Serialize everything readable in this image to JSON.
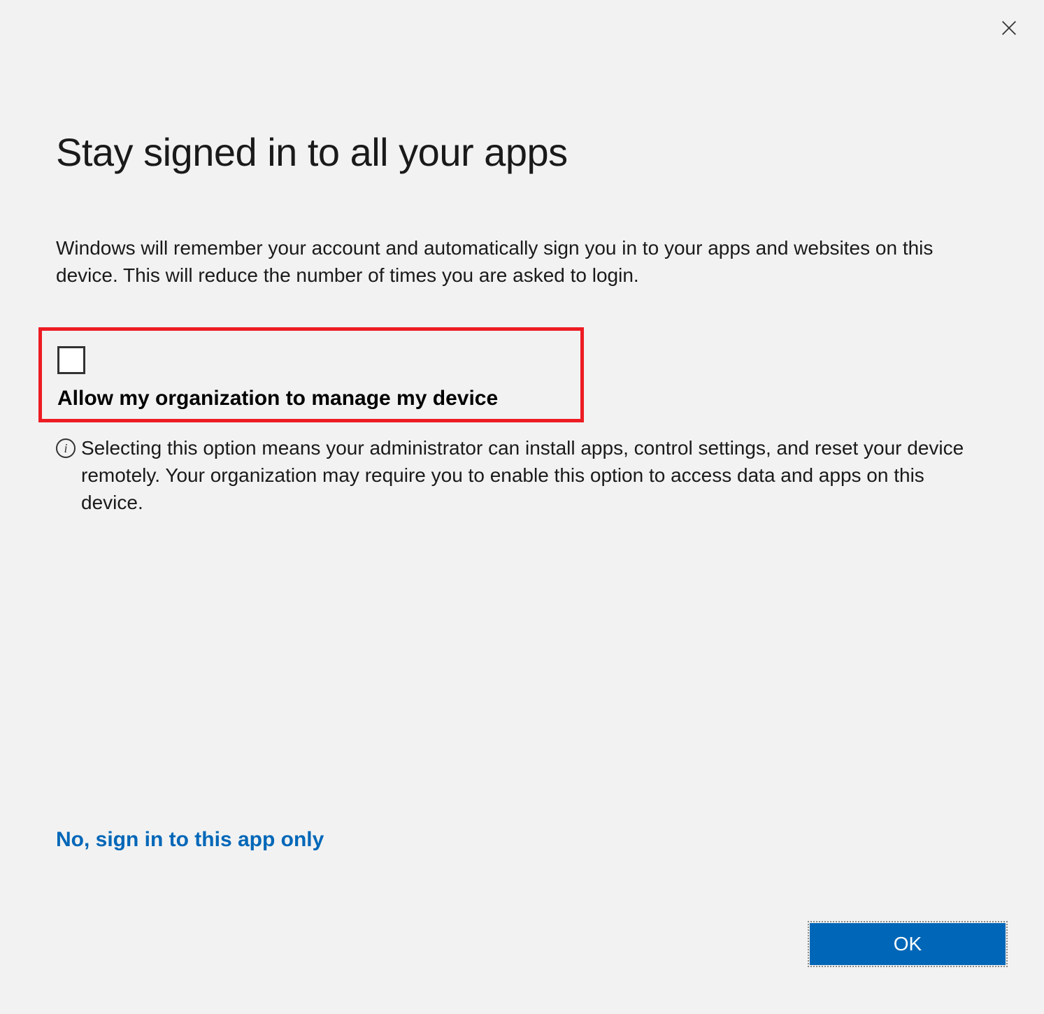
{
  "dialog": {
    "title": "Stay signed in to all your apps",
    "description": "Windows will remember your account and automatically sign you in to your apps and websites on this device. This will reduce the number of times you are asked to login.",
    "checkbox_label": "Allow my organization to manage my device",
    "checkbox_checked": false,
    "info_text": "Selecting this option means your administrator can install apps, control settings, and reset your device remotely. Your organization may require you to enable this option to access data and apps on this device.",
    "link_label": "No, sign in to this app only",
    "ok_label": "OK"
  }
}
